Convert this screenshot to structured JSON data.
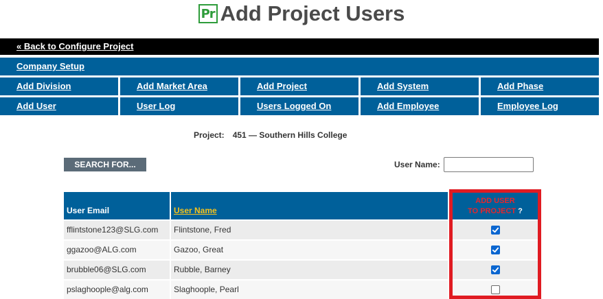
{
  "header": {
    "logo_text": "Pr",
    "title": "Add Project Users"
  },
  "nav": {
    "back_link": "« Back to Configure Project",
    "company_setup": "Company Setup",
    "row1": [
      "Add Division",
      "Add Market Area",
      "Add Project",
      "Add System",
      "Add Phase"
    ],
    "row2": [
      "Add User",
      "User Log",
      "Users Logged On",
      "Add Employee",
      "Employee Log"
    ]
  },
  "project": {
    "label": "Project:",
    "value": "451 — Southern Hills College"
  },
  "search": {
    "button_label": "SEARCH FOR...",
    "user_name_label": "User Name:",
    "user_name_value": ""
  },
  "table": {
    "headers": {
      "email": "User Email",
      "name": "User Name",
      "add_line1": "ADD USER",
      "add_line2": "TO PROJECT",
      "help": "?"
    },
    "rows": [
      {
        "email": "fflintstone123@SLG.com",
        "name": "Flintstone, Fred",
        "checked": true
      },
      {
        "email": "ggazoo@ALG.com",
        "name": "Gazoo, Great",
        "checked": true
      },
      {
        "email": "brubble06@SLG.com",
        "name": "Rubble, Barney",
        "checked": true
      },
      {
        "email": "pslaghoople@alg.com",
        "name": "Slaghoople, Pearl",
        "checked": false
      }
    ]
  },
  "colors": {
    "nav_blue": "#00609a",
    "highlight_red": "#e01b22",
    "sort_link_yellow": "#f5c21b",
    "checkbox_blue": "#0a66d0"
  }
}
